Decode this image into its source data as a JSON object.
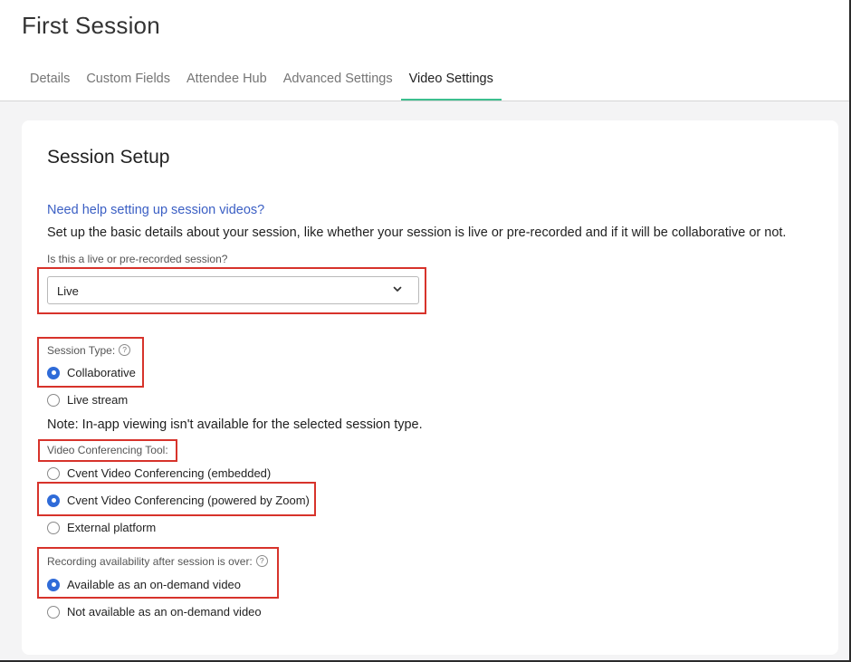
{
  "page": {
    "title": "First Session"
  },
  "tabs": [
    {
      "label": "Details"
    },
    {
      "label": "Custom Fields"
    },
    {
      "label": "Attendee Hub"
    },
    {
      "label": "Advanced Settings"
    },
    {
      "label": "Video Settings",
      "active": true
    }
  ],
  "session_setup": {
    "title": "Session Setup",
    "help_link": "Need help setting up session videos?",
    "description": "Set up the basic details about your session, like whether your session is live or pre-recorded and if it will be collaborative or not.",
    "live_question": {
      "label": "Is this a live or pre-recorded session?",
      "selected": "Live"
    },
    "session_type": {
      "label": "Session Type:",
      "options": [
        {
          "label": "Collaborative",
          "checked": true
        },
        {
          "label": "Live stream",
          "checked": false
        }
      ]
    },
    "note": "Note: In-app viewing isn't available for the selected session type.",
    "video_tool": {
      "label": "Video Conferencing Tool:",
      "options": [
        {
          "label": "Cvent Video Conferencing (embedded)",
          "checked": false
        },
        {
          "label": "Cvent Video Conferencing (powered by Zoom)",
          "checked": true
        },
        {
          "label": "External platform",
          "checked": false
        }
      ]
    },
    "recording": {
      "label": "Recording availability after session is over:",
      "options": [
        {
          "label": "Available as an on-demand video",
          "checked": true
        },
        {
          "label": "Not available as an on-demand video",
          "checked": false
        }
      ]
    }
  },
  "colors": {
    "accent_tab_underline": "#3dbf8f",
    "radio_checked": "#2f6bd8",
    "link": "#3b5fc4",
    "highlight_box": "#d7332b"
  },
  "icons": {
    "select": "chevron-down-icon",
    "help": "question-circle-icon"
  },
  "help_glyph": "?"
}
